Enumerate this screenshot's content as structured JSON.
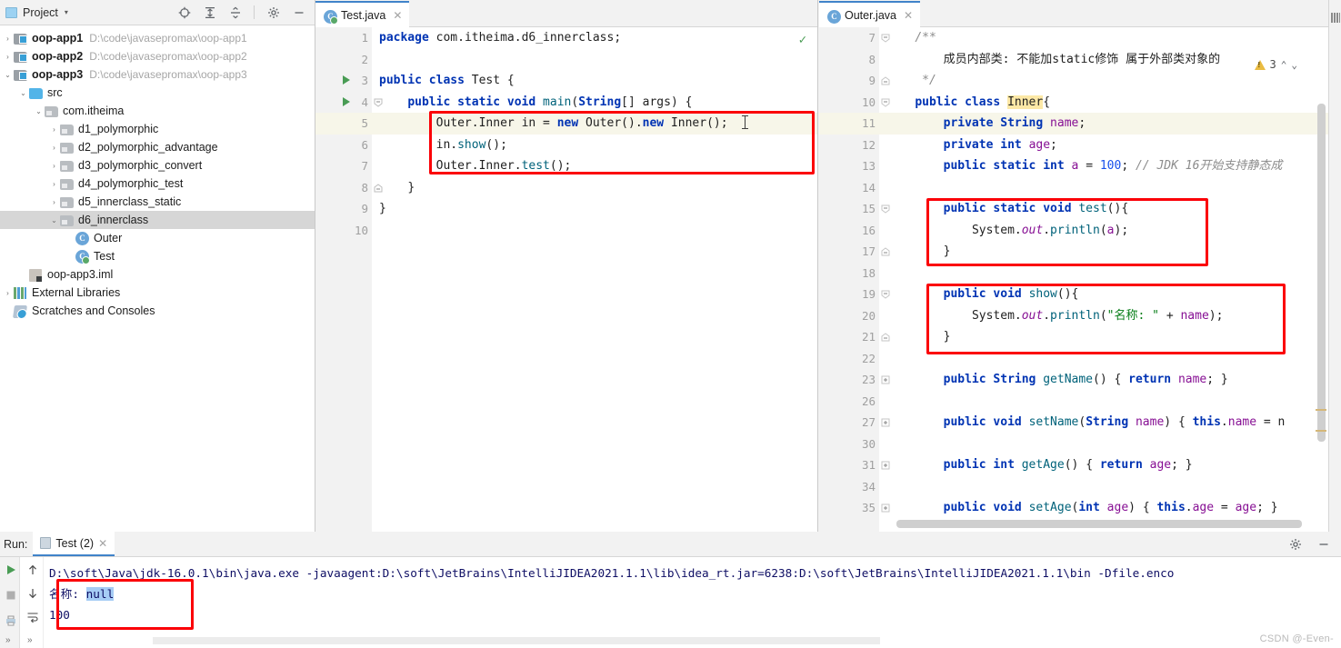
{
  "project_panel": {
    "title": "Project",
    "caret": "▾",
    "icons": [
      {
        "name": "locate-icon",
        "glyph": "⊕"
      },
      {
        "name": "expand-all-icon",
        "glyph": "⇲"
      },
      {
        "name": "collapse-all-icon",
        "glyph": "⇱"
      },
      {
        "name": "settings-gear-icon",
        "glyph": "✿"
      },
      {
        "name": "minimize-icon",
        "glyph": "—"
      }
    ],
    "tree": [
      {
        "arrow": "›",
        "icon": "module",
        "label": "oop-app1",
        "bold": true,
        "path": "D:\\code\\javasepromax\\oop-app1",
        "indent": 0,
        "selected": false
      },
      {
        "arrow": "›",
        "icon": "module",
        "label": "oop-app2",
        "bold": true,
        "path": "D:\\code\\javasepromax\\oop-app2",
        "indent": 0,
        "selected": false
      },
      {
        "arrow": "⌄",
        "icon": "module",
        "label": "oop-app3",
        "bold": true,
        "path": "D:\\code\\javasepromax\\oop-app3",
        "indent": 0,
        "selected": false
      },
      {
        "arrow": "⌄",
        "icon": "srcfolder",
        "label": "src",
        "bold": false,
        "path": "",
        "indent": 1,
        "selected": false
      },
      {
        "arrow": "⌄",
        "icon": "package",
        "label": "com.itheima",
        "bold": false,
        "path": "",
        "indent": 2,
        "selected": false
      },
      {
        "arrow": "›",
        "icon": "package",
        "label": "d1_polymorphic",
        "bold": false,
        "path": "",
        "indent": 3,
        "selected": false
      },
      {
        "arrow": "›",
        "icon": "package",
        "label": "d2_polymorphic_advantage",
        "bold": false,
        "path": "",
        "indent": 3,
        "selected": false
      },
      {
        "arrow": "›",
        "icon": "package",
        "label": "d3_polymorphic_convert",
        "bold": false,
        "path": "",
        "indent": 3,
        "selected": false
      },
      {
        "arrow": "›",
        "icon": "package",
        "label": "d4_polymorphic_test",
        "bold": false,
        "path": "",
        "indent": 3,
        "selected": false
      },
      {
        "arrow": "›",
        "icon": "package",
        "label": "d5_innerclass_static",
        "bold": false,
        "path": "",
        "indent": 3,
        "selected": false
      },
      {
        "arrow": "⌄",
        "icon": "package",
        "label": "d6_innerclass",
        "bold": false,
        "path": "",
        "indent": 3,
        "selected": true
      },
      {
        "arrow": "",
        "icon": "class",
        "label": "Outer",
        "bold": false,
        "path": "",
        "indent": 4,
        "selected": false
      },
      {
        "arrow": "",
        "icon": "class-run",
        "label": "Test",
        "bold": false,
        "path": "",
        "indent": 4,
        "selected": false
      },
      {
        "arrow": "",
        "icon": "iml",
        "label": "oop-app3.iml",
        "bold": false,
        "path": "",
        "indent": 1,
        "selected": false
      },
      {
        "arrow": "›",
        "icon": "lib",
        "label": "External Libraries",
        "bold": false,
        "path": "",
        "indent": 0,
        "selected": false
      },
      {
        "arrow": "",
        "icon": "scratch",
        "label": "Scratches and Consoles",
        "bold": false,
        "path": "",
        "indent": 0,
        "selected": false
      }
    ]
  },
  "editor_left": {
    "tab": {
      "label": "Test.java",
      "icon": "java-class-icon",
      "close": "✕"
    },
    "inspection_ok": "✓",
    "gutter": [
      "1",
      "2",
      "3",
      "4",
      "5",
      "6",
      "7",
      "8",
      "9",
      "10"
    ],
    "lines": [
      "package com.itheima.d6_innerclass;",
      "",
      "public class Test {",
      "    public static void main(String[] args) {",
      "        Outer.Inner in = new Outer().new Inner();",
      "        in.show();",
      "        Outer.Inner.test();",
      "    }",
      "}",
      ""
    ]
  },
  "editor_right": {
    "tab": {
      "label": "Outer.java",
      "icon": "java-class-icon",
      "close": "✕"
    },
    "warning": {
      "count": "3",
      "up": "⌃",
      "down": "⌄"
    },
    "gutter": [
      "7",
      "8",
      "9",
      "10",
      "11",
      "12",
      "13",
      "14",
      "15",
      "16",
      "17",
      "18",
      "19",
      "20",
      "21",
      "22",
      "23",
      "26",
      "27",
      "30",
      "31",
      "34",
      "35"
    ],
    "lines": [
      "    /**",
      "        成员内部类: 不能加static修饰 属于外部类对象的",
      "     */",
      "    public class Inner{",
      "        private String name;",
      "        private int age;",
      "        public static int a = 100; // JDK 16开始支持静态成",
      "",
      "        public static void test(){",
      "            System.out.println(a);",
      "        }",
      "",
      "        public void show(){",
      "            System.out.println(\"名称: \" + name);",
      "        }",
      "",
      "        public String getName() { return name; }",
      "",
      "        public void setName(String name) { this.name = n",
      "",
      "        public int getAge() { return age; }",
      "",
      "        public void setAge(int age) { this.age = age; }"
    ]
  },
  "right_sidebar": {
    "label": "Database",
    "icon": "database-icon"
  },
  "run_panel": {
    "label": "Run:",
    "tab": {
      "label": "Test (2)",
      "close": "✕"
    },
    "header_icons": [
      {
        "name": "settings-gear-icon",
        "glyph": "✿"
      },
      {
        "name": "minimize-icon",
        "glyph": "—"
      }
    ],
    "toolbar_icons": [
      {
        "name": "rerun-icon",
        "glyph": "▶"
      },
      {
        "name": "stop-icon",
        "glyph": "■"
      },
      {
        "name": "print-icon",
        "glyph": "⎙"
      },
      {
        "name": "expand-strip-icon",
        "glyph": "»"
      }
    ],
    "toolbar2_icons": [
      {
        "name": "scroll-up-icon",
        "glyph": "↑"
      },
      {
        "name": "scroll-down-icon",
        "glyph": "↓"
      },
      {
        "name": "soft-wrap-icon",
        "glyph": "⇥"
      },
      {
        "name": "expand-strip2-icon",
        "glyph": "»"
      }
    ],
    "console": {
      "command": "D:\\soft\\Java\\jdk-16.0.1\\bin\\java.exe -javaagent:D:\\soft\\JetBrains\\IntelliJIDEA2021.1.1\\lib\\idea_rt.jar=6238:D:\\soft\\JetBrains\\IntelliJIDEA2021.1.1\\bin -Dfile.enco",
      "output_line1_prefix": "名称: ",
      "output_line1_value": "null",
      "output_line2": "100"
    }
  },
  "watermark": "CSDN @-Even-",
  "colors": {
    "accent": "#4083c9",
    "annotation_red": "#fb0007",
    "keyword": "#0033b3",
    "string": "#067d17",
    "comment": "#8c8c8c",
    "number": "#1750eb",
    "field": "#871094",
    "method": "#00627a",
    "selection": "#a6ccf5",
    "line_highlight": "#f7f6e9",
    "warning_yellow": "#eabc42"
  }
}
